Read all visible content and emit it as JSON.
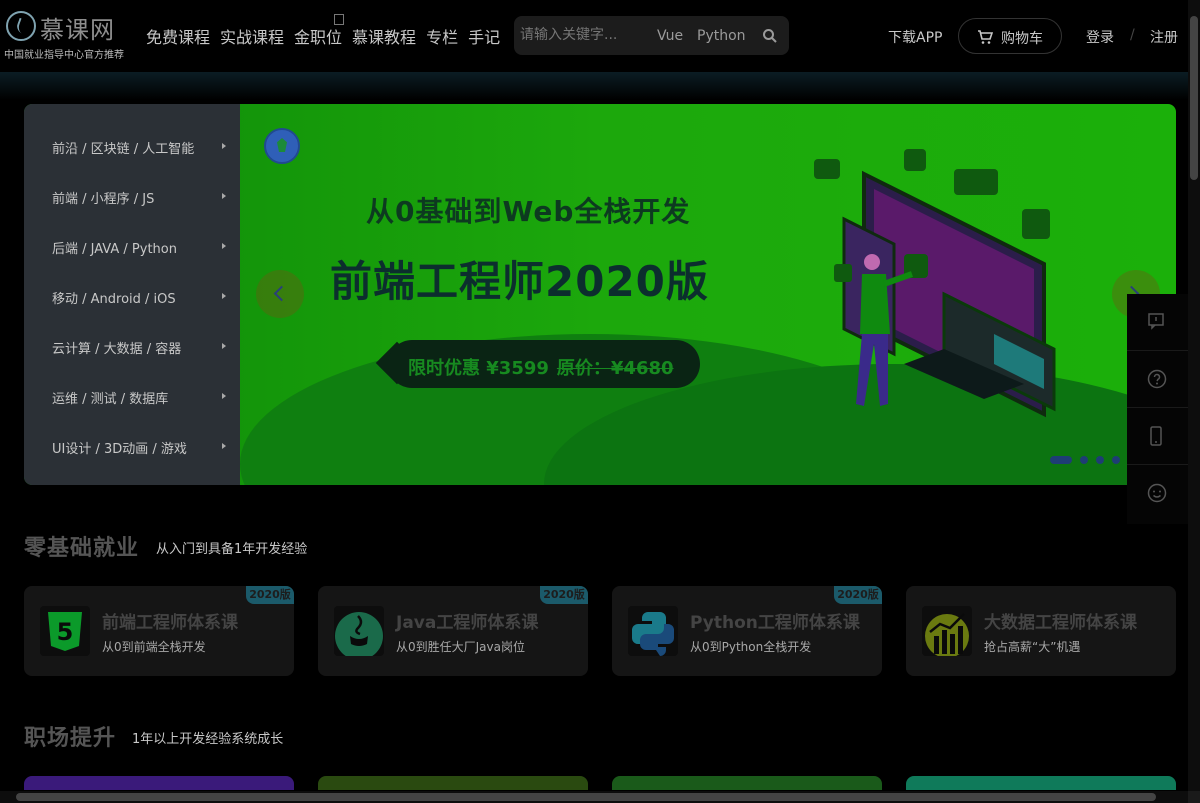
{
  "header": {
    "logo_text": "慕课网",
    "logo_sub": "中国就业指导中心官方推荐",
    "nav": [
      "免费课程",
      "实战课程",
      "金职位",
      "慕课教程",
      "专栏",
      "手记"
    ],
    "search_placeholder": "请输入关键字...",
    "search_tags": [
      "Vue",
      "Python"
    ],
    "download": "下载APP",
    "cart": "购物车",
    "login": "登录",
    "separator": "/",
    "register": "注册"
  },
  "banner": {
    "menu": [
      "前沿 / 区块链 / 人工智能",
      "前端 / 小程序 / JS",
      "后端 / JAVA / Python",
      "移动 / Android / iOS",
      "云计算 / 大数据 / 容器",
      "运维 / 测试 / 数据库",
      "UI设计 / 3D动画 / 游戏"
    ],
    "title1": "从0基础到Web全栈开发",
    "title2": "前端工程师2020版",
    "promo": "限时优惠 ¥3599",
    "original_price": "原价：¥4680",
    "slides_count": 5,
    "active_slide": 0
  },
  "section1": {
    "title": "零基础就业",
    "subtitle": "从入门到具备1年开发经验",
    "cards": [
      {
        "badge": "2020版",
        "title": "前端工程师体系课",
        "sub": "从0到前端全栈开发",
        "icon": "html5-icon"
      },
      {
        "badge": "2020版",
        "title": "Java工程师体系课",
        "sub": "从0到胜任大厂Java岗位",
        "icon": "java-icon"
      },
      {
        "badge": "2020版",
        "title": "Python工程师体系课",
        "sub": "从0到Python全栈开发",
        "icon": "python-icon"
      },
      {
        "badge": "",
        "title": "大数据工程师体系课",
        "sub": "抢占高薪“大”机遇",
        "icon": "bigdata-icon"
      }
    ]
  },
  "section2": {
    "title": "职场提升",
    "subtitle": "1年以上开发经验系统成长"
  },
  "side_tools": [
    "message-icon",
    "help-icon",
    "phone-icon",
    "feedback-icon"
  ]
}
